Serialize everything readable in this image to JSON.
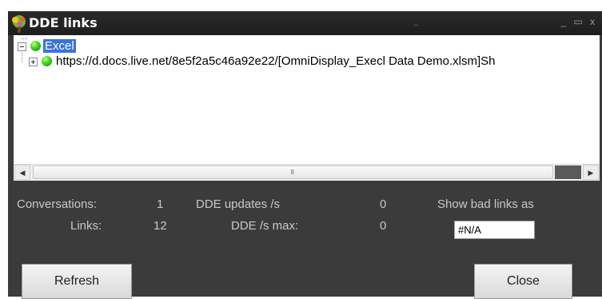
{
  "window": {
    "title": "DDE links",
    "minimize_glyph": "_",
    "maximize_glyph": "▭",
    "close_glyph": "x"
  },
  "tree": {
    "root": {
      "label": "Excel",
      "status": "green",
      "expanded": true
    },
    "children": [
      {
        "label": "https://d.docs.live.net/8e5f2a5c46a92e22/[OmniDisplay_Execl Data Demo.xlsm]Sh",
        "status": "green",
        "expanded": false
      }
    ]
  },
  "scrollbar": {
    "left_arrow": "◀",
    "right_arrow": "▶",
    "grip": "III"
  },
  "stats": {
    "conversations_label": "Conversations:",
    "conversations_value": "1",
    "links_label": "Links:",
    "links_value": "12",
    "dde_updates_label": "DDE updates /s",
    "dde_updates_value": "0",
    "dde_max_label": "DDE /s max:",
    "dde_max_value": "0"
  },
  "bad_links": {
    "label": "Show bad links as",
    "value": "#N/A"
  },
  "buttons": {
    "refresh": "Refresh",
    "close": "Close"
  },
  "colors": {
    "window_bg": "#3b3b3b",
    "selection": "#3a73d9",
    "status_green": "#3fd11b"
  }
}
